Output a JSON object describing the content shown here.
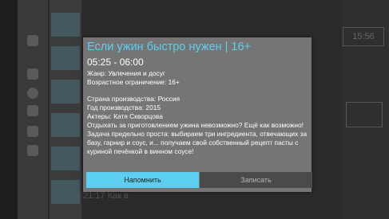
{
  "background": {
    "right_badge": "15:56",
    "footer_text": "21:17 Как в"
  },
  "dialog": {
    "title": "Если ужин быстро нужен | 16+",
    "time": "05:25 - 06:00",
    "genre": "Жанр: Увлечения и досуг",
    "age": "Возрастное ограничение: 16+",
    "country": "Страна производства: Россия",
    "year": "Год производства: 2015",
    "actors": "Актеры: Катя Скворцова",
    "description": "Отдыхать за приготовлением ужина невозможно? Ещё как возможно! Задача предельно проста: выбираем три ингредиента, отвечающих за базу, гарнир и соус, и... получаем свой собственный рецепт пасты с куриной печёнкой в винном соусе!",
    "buttons": {
      "remind": "Напомнить",
      "record": "Записать"
    }
  },
  "colors": {
    "accent": "#5ccff0",
    "dialog_bg": "#757575",
    "record_bg": "#4a4a4a"
  }
}
